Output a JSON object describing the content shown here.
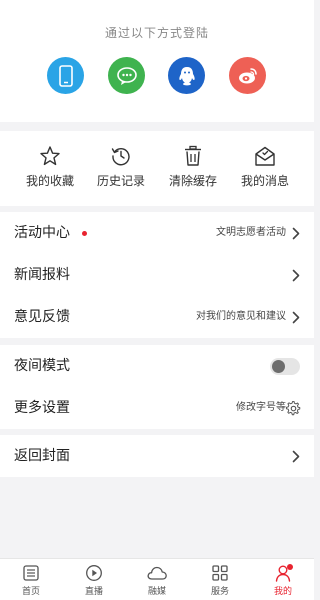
{
  "login": {
    "title": "通过以下方式登陆",
    "methods": [
      {
        "icon": "phone-icon",
        "color": "#2aa4e6"
      },
      {
        "icon": "wechat-icon",
        "color": "#3fb34f"
      },
      {
        "icon": "qq-icon",
        "color": "#1e64c8"
      },
      {
        "icon": "weibo-icon",
        "color": "#ee6055"
      }
    ]
  },
  "quick_actions": [
    {
      "label": "我的收藏",
      "icon": "star-icon"
    },
    {
      "label": "历史记录",
      "icon": "history-icon"
    },
    {
      "label": "清除缓存",
      "icon": "trash-icon"
    },
    {
      "label": "我的消息",
      "icon": "envelope-icon"
    }
  ],
  "menu": {
    "activity": {
      "label": "活动中心",
      "value": "文明志愿者活动"
    },
    "news_report": {
      "label": "新闻报料"
    },
    "feedback": {
      "label": "意见反馈",
      "value": "对我们的意见和建议"
    },
    "night_mode": {
      "label": "夜间模式",
      "enabled": false
    },
    "more_settings": {
      "label": "更多设置",
      "value": "修改字号等"
    },
    "back_cover": {
      "label": "返回封面"
    }
  },
  "tabbar": {
    "items": [
      {
        "label": "首页",
        "icon": "home-list-icon"
      },
      {
        "label": "直播",
        "icon": "play-icon"
      },
      {
        "label": "融媒",
        "icon": "cloud-icon"
      },
      {
        "label": "服务",
        "icon": "grid-icon"
      },
      {
        "label": "我的",
        "icon": "person-icon"
      }
    ],
    "active": "我的"
  },
  "colors": {
    "accent": "#e8232f",
    "background": "#f3f3f5"
  }
}
